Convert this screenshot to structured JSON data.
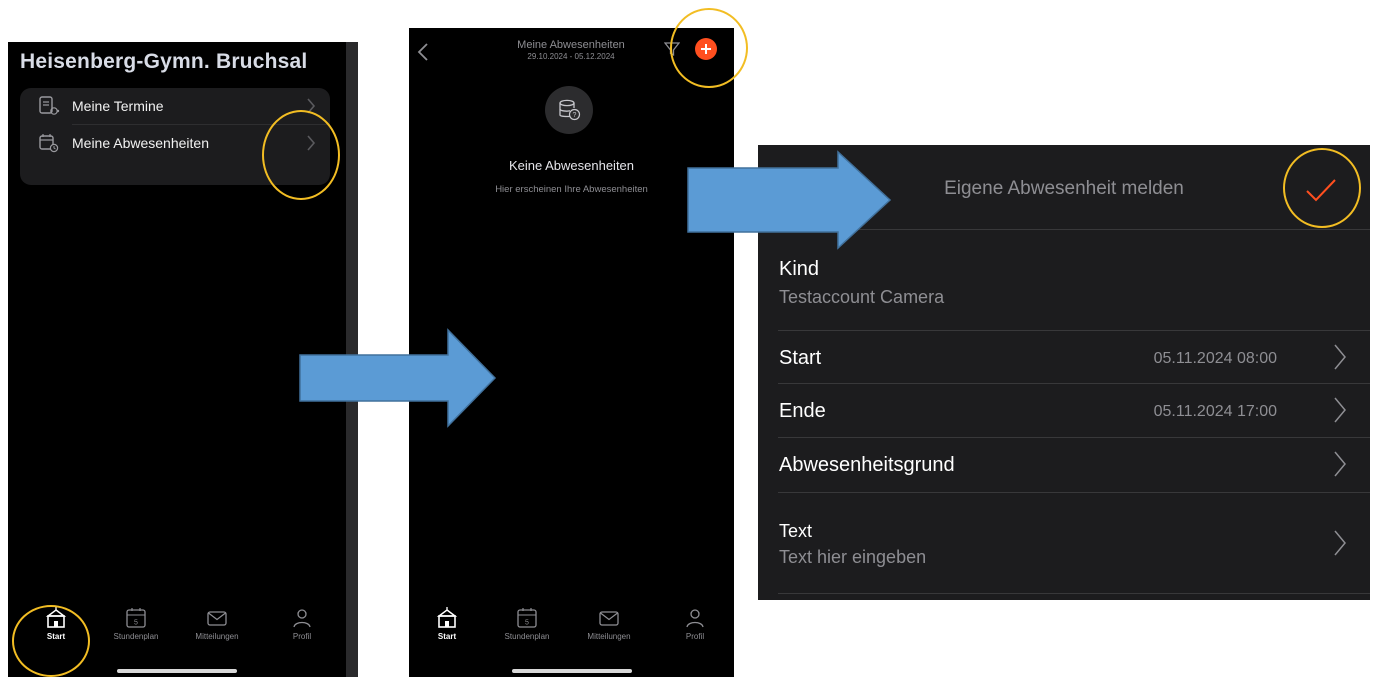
{
  "screen1": {
    "school_name": "Heisenberg-Gymn. Bruchsal",
    "menu": [
      {
        "label": "Meine Termine",
        "icon": "appointments-icon"
      },
      {
        "label": "Meine Abwesenheiten",
        "icon": "absence-calendar-icon"
      }
    ]
  },
  "tabs": [
    {
      "label": "Start",
      "icon": "school-icon",
      "active": true
    },
    {
      "label": "Stundenplan",
      "icon": "timetable-icon",
      "active": false
    },
    {
      "label": "Mitteilungen",
      "icon": "mail-icon",
      "active": false
    },
    {
      "label": "Profil",
      "icon": "person-icon",
      "active": false
    }
  ],
  "screen2": {
    "nav_title": "Meine Abwesenheiten",
    "nav_subtitle": "29.10.2024 - 05.12.2024",
    "empty_title": "Keine Abwesenheiten",
    "empty_subtitle": "Hier erscheinen Ihre Abwesenheiten"
  },
  "screen3": {
    "title": "Eigene Abwesenheit melden",
    "rows": {
      "kind": {
        "label": "Kind",
        "value": "Testaccount Camera"
      },
      "start": {
        "label": "Start",
        "value": "05.11.2024 08:00"
      },
      "end": {
        "label": "Ende",
        "value": "05.11.2024 17:00"
      },
      "reason": {
        "label": "Abwesenheitsgrund"
      },
      "text": {
        "label": "Text",
        "placeholder": "Text hier eingeben"
      }
    }
  },
  "colors": {
    "background": "#000000",
    "accent_orange": "#ff4f1f",
    "annotation_ring": "#f2bd23",
    "annotation_arrow": "#5b9bd5",
    "secondary_text": "#8e8e93"
  }
}
